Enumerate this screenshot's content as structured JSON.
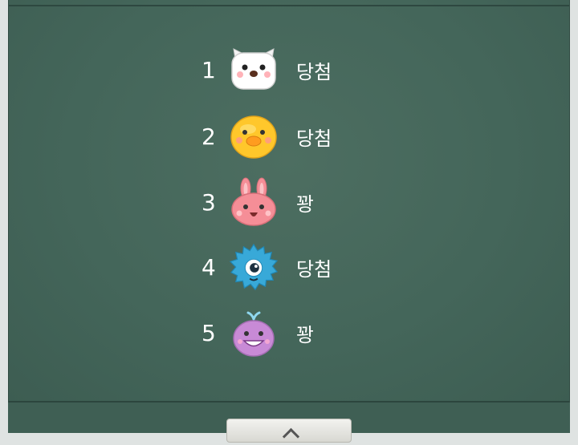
{
  "results": [
    {
      "number": "1",
      "character": "white-cat",
      "result": "당첨"
    },
    {
      "number": "2",
      "character": "yellow-chick",
      "result": "당첨"
    },
    {
      "number": "3",
      "character": "pink-rabbit",
      "result": "꽝"
    },
    {
      "number": "4",
      "character": "blue-hedgehog",
      "result": "당첨"
    },
    {
      "number": "5",
      "character": "purple-whale",
      "result": "꽝"
    }
  ],
  "colors": {
    "board": "#44665a",
    "text": "#ffffff"
  }
}
